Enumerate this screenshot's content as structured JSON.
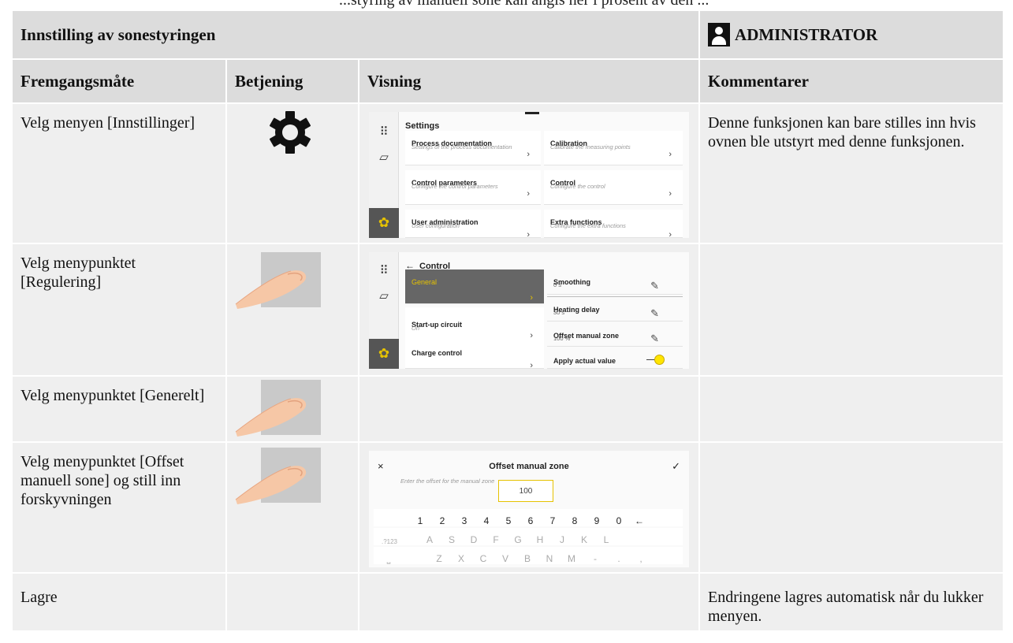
{
  "top_fragment": "...styring av manuell sone kan angis her i prosent av den ...",
  "title_row": {
    "title": "Innstilling av sonestyringen",
    "role": "ADMINISTRATOR",
    "role_icon": "person-icon"
  },
  "columns": [
    "Fremgangsmåte",
    "Betjening",
    "Visning",
    "Kommentarer"
  ],
  "steps": [
    {
      "procedure": "Velg menyen [Innstillinger]",
      "operation_icon": "gear-icon",
      "comment": "Denne funksjonen kan bare stilles inn hvis ovnen ble utstyrt med denne funksjonen."
    },
    {
      "procedure": "Velg menypunktet [Regulering]",
      "operation_icon": "finger-tap-icon",
      "comment": ""
    },
    {
      "procedure": "Velg menypunktet [Generelt]",
      "operation_icon": "finger-tap-icon",
      "comment": ""
    },
    {
      "procedure": "Velg menypunktet [Offset manuell sone] og still inn forskyvningen",
      "operation_icon": "finger-tap-icon",
      "comment": ""
    },
    {
      "procedure": "Lagre",
      "operation_icon": "",
      "comment": "Endringene lagres automatisk når du lukker menyen."
    }
  ],
  "settings_screen": {
    "title": "Settings",
    "cards": [
      {
        "title": "Process documentation",
        "sub": "Settings of the process documentation"
      },
      {
        "title": "Calibration",
        "sub": "Calibrate the measuring points"
      },
      {
        "title": "Control parameters",
        "sub": "Configure the control parameters"
      },
      {
        "title": "Control",
        "sub": "Configure the control"
      },
      {
        "title": "User administration",
        "sub": "User configuration"
      },
      {
        "title": "Extra functions",
        "sub": "Configure the extra functions"
      }
    ]
  },
  "control_screen": {
    "back": "←",
    "title": "Control",
    "left_items": [
      {
        "title": "General",
        "sub": "",
        "selected": true
      },
      {
        "title": "Start-up circuit",
        "sub": "On",
        "selected": false
      },
      {
        "title": "Charge control",
        "sub": "",
        "selected": false
      }
    ],
    "right_items": [
      {
        "title": "Smoothing",
        "value": "0 s"
      },
      {
        "title": "Heating delay",
        "value": "30 s"
      },
      {
        "title": "Offset manual zone",
        "value": "100 %"
      },
      {
        "title": "Apply actual value",
        "value": ""
      }
    ],
    "accent_color": "#e6c200"
  },
  "keyboard_screen": {
    "close": "×",
    "confirm": "✓",
    "title": "Offset manual zone",
    "prompt": "Enter the offset for the manual zone",
    "value": "100",
    "row1": [
      "1",
      "2",
      "3",
      "4",
      "5",
      "6",
      "7",
      "8",
      "9",
      "0",
      "←"
    ],
    "row2": [
      ".?123",
      "A",
      "S",
      "D",
      "F",
      "G",
      "H",
      "J",
      "K",
      "L"
    ],
    "row3": [
      "⎵",
      "Z",
      "X",
      "C",
      "V",
      "B",
      "N",
      "M",
      "-",
      ".",
      ","
    ]
  }
}
